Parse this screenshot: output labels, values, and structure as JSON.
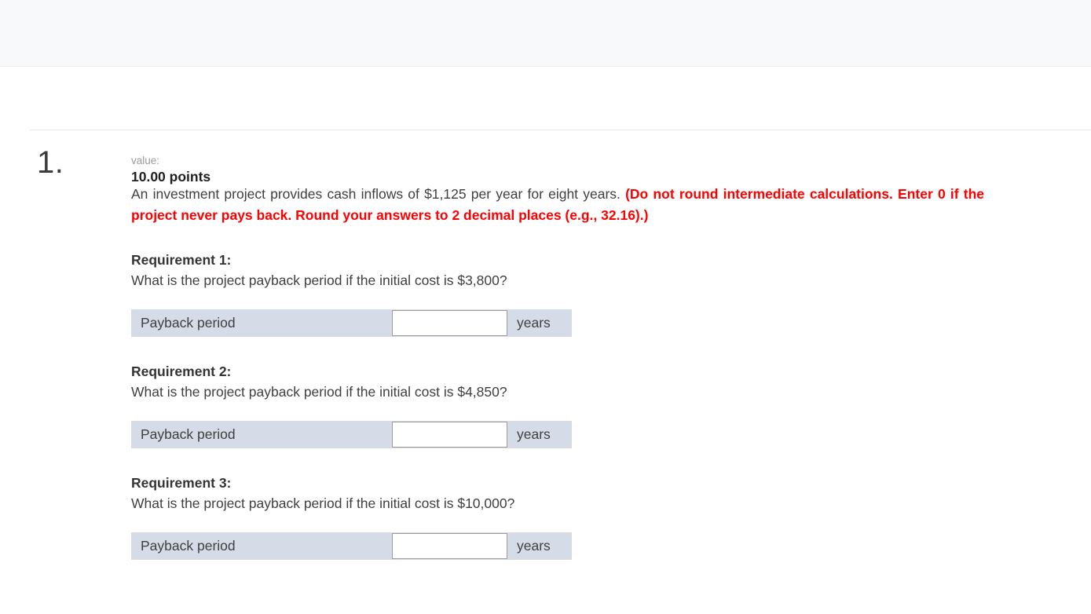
{
  "toolbar": {
    "present": true
  },
  "question_header": {
    "number": "1.",
    "value_label": "value:",
    "value_amount": "10.00 points"
  },
  "stem": {
    "plain_before": "An investment project provides cash inflows of $1,125 per year for eight years. ",
    "highlight": "(Do not round intermediate calculations. Enter 0 if the project never pays back. Round your answers to 2 decimal places (e.g., 32.16).)",
    "highlight_color": "#ff0000"
  },
  "requirements": [
    {
      "title": "Requirement 1:",
      "question": "What is the project payback period if the initial cost is $3,800?",
      "row_label": "Payback period",
      "input_value": "",
      "input_placeholder": "",
      "unit": "years"
    },
    {
      "title": "Requirement 2:",
      "question": "What is the project payback period if the initial cost is $4,850?",
      "row_label": "Payback period",
      "input_value": "",
      "input_placeholder": "",
      "unit": "years"
    },
    {
      "title": "Requirement 3:",
      "question": "What is the project payback period if the initial cost is $10,000?",
      "row_label": "Payback period",
      "input_value": "",
      "input_placeholder": "",
      "unit": "years"
    }
  ],
  "theme": {
    "toolbar_bg": "#f8f9fa",
    "table_bg": "#d6dce7",
    "input_border": "#9c9c9c",
    "body_text": "#3f3f3f",
    "rule": "#e8e8e8"
  }
}
